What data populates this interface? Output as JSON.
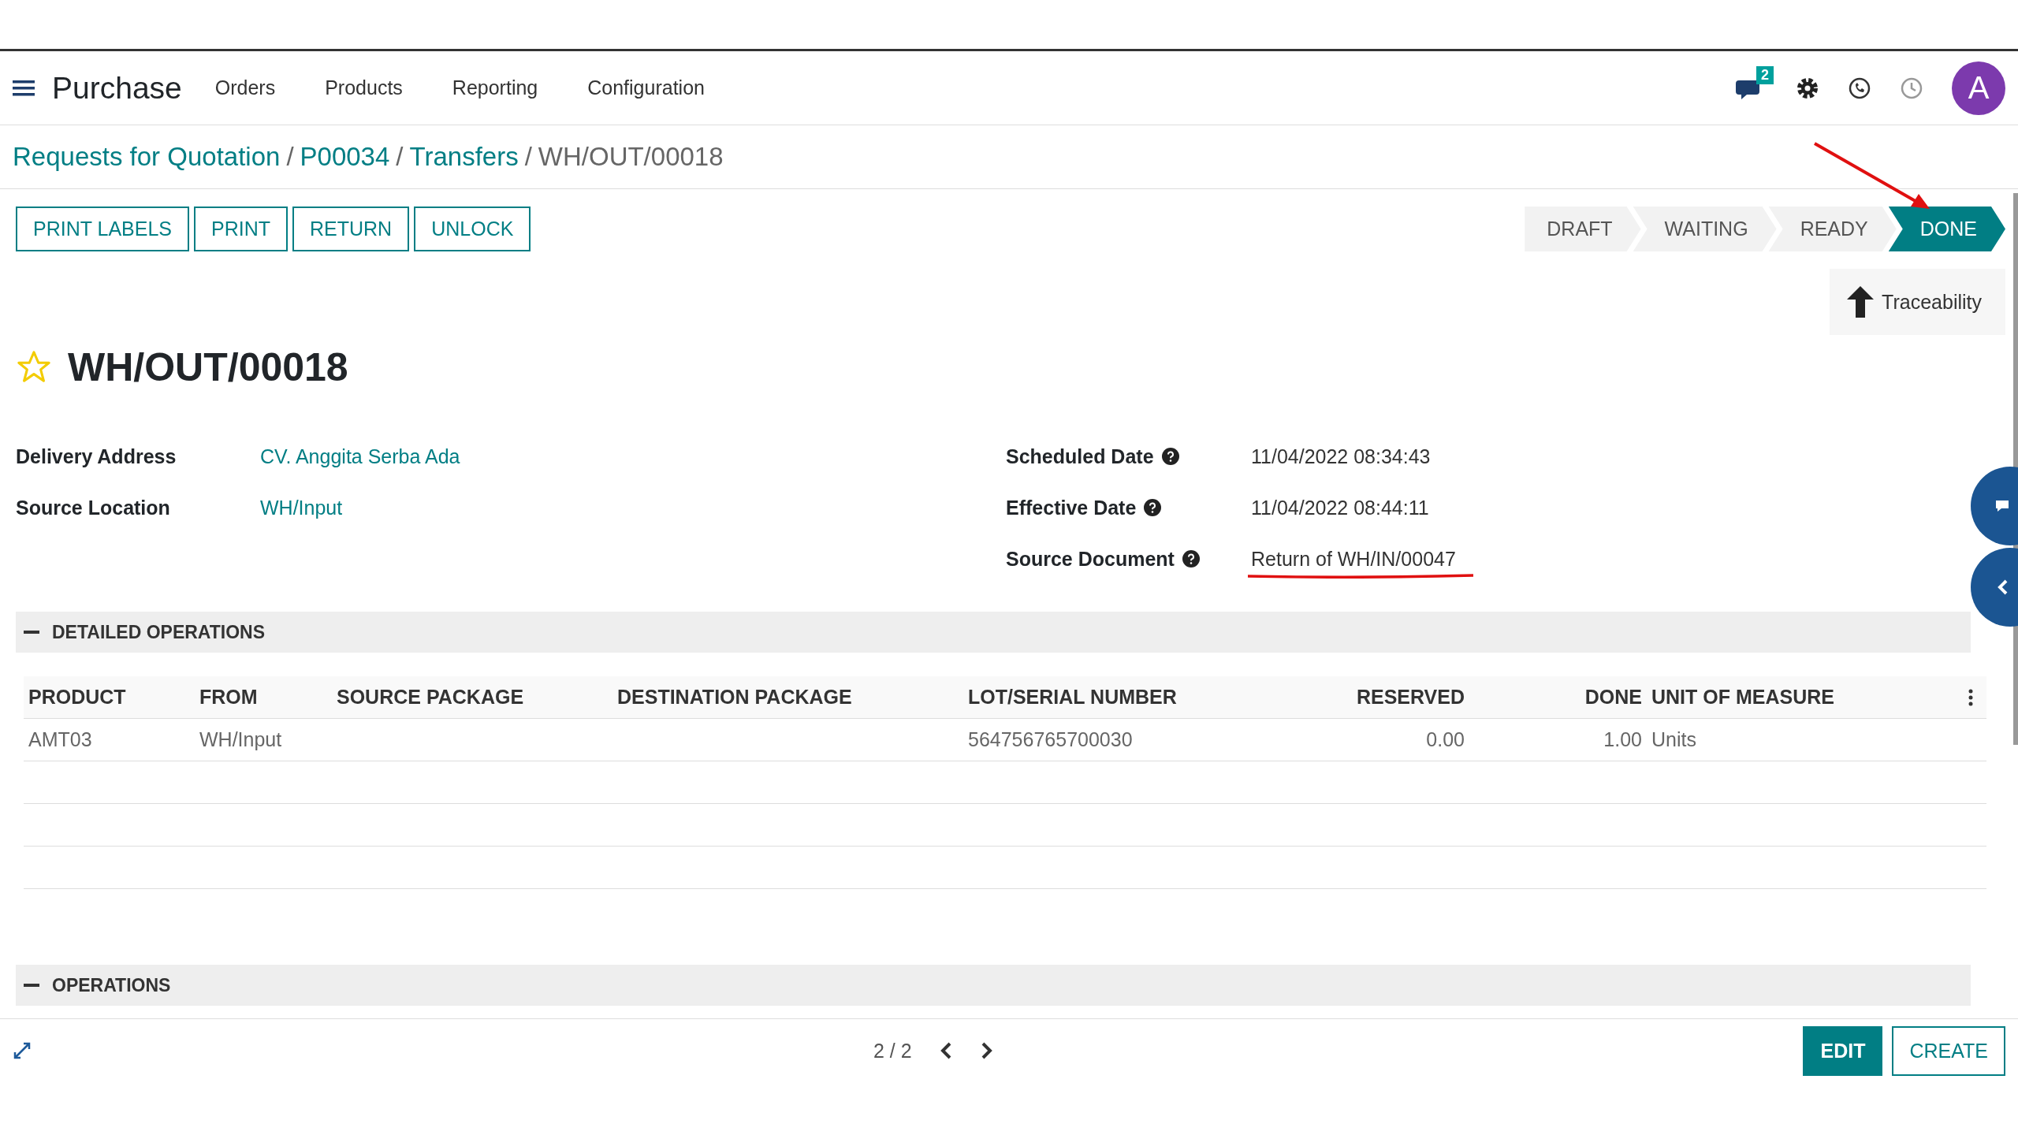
{
  "navbar": {
    "app_name": "Purchase",
    "menu": [
      "Orders",
      "Products",
      "Reporting",
      "Configuration"
    ],
    "messages_badge": "2",
    "avatar": "A"
  },
  "breadcrumb_separator": "/",
  "breadcrumbs": [
    {
      "label": "Requests for Quotation",
      "link": true
    },
    {
      "label": "P00034",
      "link": true
    },
    {
      "label": "Transfers",
      "link": true
    },
    {
      "label": "WH/OUT/00018",
      "link": false
    }
  ],
  "actions": [
    "PRINT LABELS",
    "PRINT",
    "RETURN",
    "UNLOCK"
  ],
  "stages": [
    {
      "label": "DRAFT",
      "selected": false
    },
    {
      "label": "WAITING",
      "selected": false
    },
    {
      "label": "READY",
      "selected": false
    },
    {
      "label": "DONE",
      "selected": true
    }
  ],
  "smart_button": {
    "label": "Traceability"
  },
  "record": {
    "title": "WH/OUT/00018",
    "starred": false
  },
  "fields_left": [
    {
      "label": "Delivery Address",
      "value": "CV. Anggita Serba Ada",
      "link": true
    },
    {
      "label": "Source Location",
      "value": "WH/Input",
      "link": true
    }
  ],
  "fields_right": [
    {
      "label": "Scheduled Date",
      "value": "11/04/2022 08:34:43",
      "help": true
    },
    {
      "label": "Effective Date",
      "value": "11/04/2022 08:44:11",
      "help": true
    },
    {
      "label": "Source Document",
      "value": "Return of WH/IN/00047",
      "help": true
    }
  ],
  "detailed_operations": {
    "title": "DETAILED OPERATIONS",
    "expanded": true,
    "columns": [
      "PRODUCT",
      "FROM",
      "SOURCE PACKAGE",
      "DESTINATION PACKAGE",
      "LOT/SERIAL NUMBER",
      "RESERVED",
      "DONE",
      "UNIT OF MEASURE"
    ],
    "rows": [
      {
        "product": "AMT03",
        "from": "WH/Input",
        "lot_serial_number": "564756765700030",
        "reserved": "0.00",
        "done": "1.00",
        "unit_of_measure": "Units"
      }
    ]
  },
  "operations": {
    "title": "OPERATIONS",
    "expanded": true
  },
  "pager": "2 / 2",
  "bottom_buttons": [
    {
      "label": "EDIT",
      "primary": true
    },
    {
      "label": "CREATE",
      "primary": false
    }
  ]
}
